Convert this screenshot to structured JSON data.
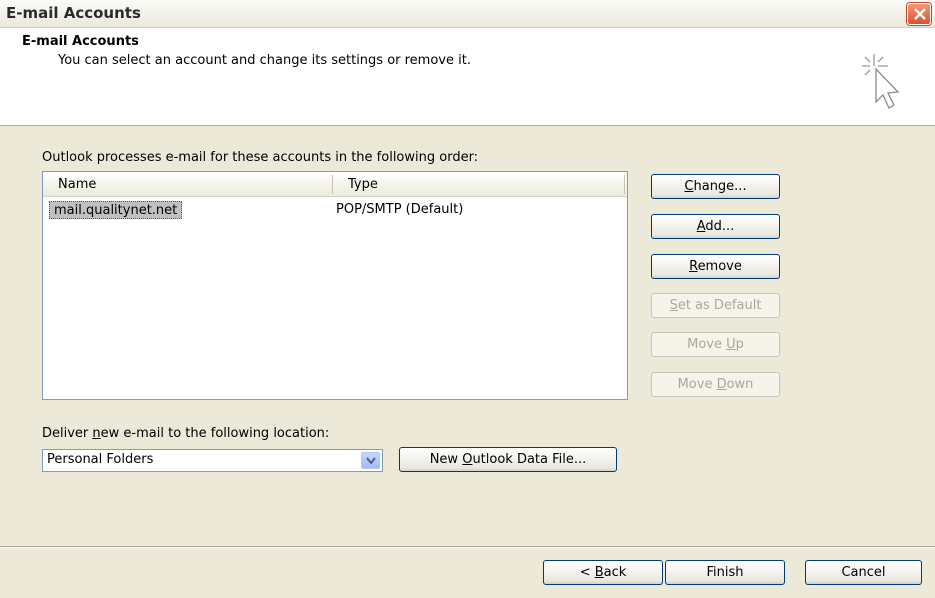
{
  "window": {
    "title": "E-mail Accounts"
  },
  "header": {
    "title": "E-mail Accounts",
    "subtitle": "You can select an account and change its settings or remove it.",
    "icon": "cursor-sparkle-icon"
  },
  "accounts": {
    "order_label": "Outlook processes e-mail for these accounts in the following order:",
    "columns": [
      "Name",
      "Type"
    ],
    "rows": [
      {
        "name": "mail.qualitynet.net",
        "type": "POP/SMTP (Default)"
      }
    ]
  },
  "buttons": {
    "change_pre": "",
    "change_key": "C",
    "change_post": "hange...",
    "add_pre": "",
    "add_key": "A",
    "add_post": "dd...",
    "remove_pre": "",
    "remove_key": "R",
    "remove_post": "emove",
    "default_pre": "",
    "default_key": "S",
    "default_post": "et as Default",
    "up_pre": "Move ",
    "up_key": "U",
    "up_post": "p",
    "down_pre": "Move ",
    "down_key": "D",
    "down_post": "own"
  },
  "deliver": {
    "label_pre": "Deliver ",
    "label_key": "n",
    "label_post": "ew e-mail to the following location:",
    "selected": "Personal Folders",
    "newfile_pre": "New ",
    "newfile_key": "O",
    "newfile_post": "utlook Data File..."
  },
  "footer": {
    "back_pre": "< ",
    "back_key": "B",
    "back_post": "ack",
    "finish": "Finish",
    "cancel": "Cancel"
  },
  "colors": {
    "dialog_bg": "#ece9d8",
    "button_border": "#003c74",
    "close_red": "#d9532c"
  }
}
